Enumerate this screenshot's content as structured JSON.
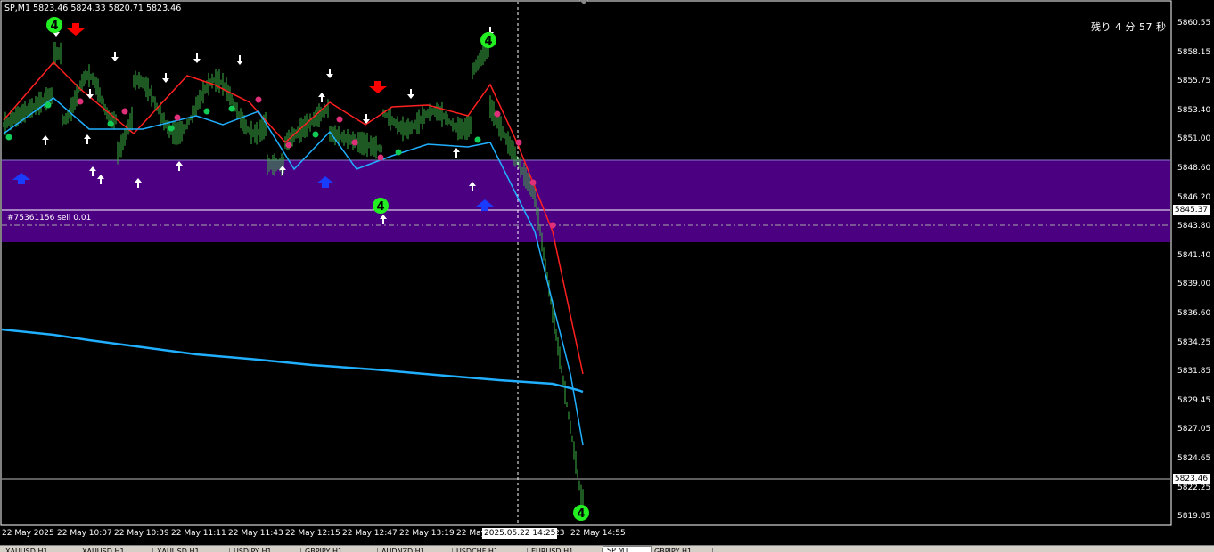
{
  "chart": {
    "symbol_header": "SP,M1  5823.46 5824.33 5820.71 5823.46",
    "timer_text": "残り 4 分 57 秒",
    "order_label": "#75361156 sell 0.01",
    "price_ticks": [
      "5860.55",
      "5858.15",
      "5855.75",
      "5853.40",
      "5851.00",
      "5848.60",
      "5846.20",
      "5843.80",
      "5841.40",
      "5839.00",
      "5836.60",
      "5834.25",
      "5831.85",
      "5829.45",
      "5827.05",
      "5824.65",
      "5822.25",
      "5819.85"
    ],
    "order_price_box": "5845.37",
    "current_price_box": "5823.46",
    "time_ticks": [
      "22 May 2025",
      "22 May 10:07",
      "22 May 10:39",
      "22 May 11:11",
      "22 May 11:43",
      "22 May 12:15",
      "22 May 12:47",
      "22 May 13:19",
      "22 May 13:",
      ":23",
      "22 May 14:55"
    ],
    "cursor_time": "2025.05.22 14:25",
    "signal_number": "4",
    "colors": {
      "background": "#000000",
      "candle": "#3cb043",
      "zone": "#4b0082",
      "upper_band": "#ff2020",
      "lower_band": "#20b0ff",
      "slow_ma": "#20b0ff",
      "arrow": "#ffffff",
      "big_arrow_down": "#ff0000",
      "big_arrow_up": "#1a3cff",
      "signal_circle": "#22ee22"
    }
  },
  "tabs": [
    {
      "label": "XAUUSD,H1"
    },
    {
      "label": "XAUUSD,H1"
    },
    {
      "label": "XAUUSD,H1"
    },
    {
      "label": "USDJPY,H1"
    },
    {
      "label": "GBPJPY,H1"
    },
    {
      "label": "AUDNZD,H1"
    },
    {
      "label": "USDCHF,H1"
    },
    {
      "label": "EURUSD,H1"
    },
    {
      "label": "SP,M1"
    },
    {
      "label": "GBPJPY,H1"
    }
  ]
}
